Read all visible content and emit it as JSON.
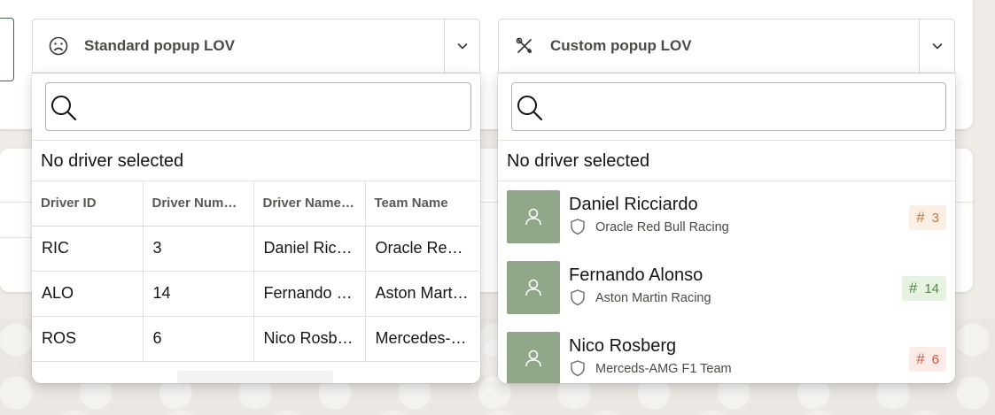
{
  "standard_lov": {
    "label": "Standard popup LOV",
    "icon": "sad-face-icon",
    "search_placeholder": "",
    "no_selection": "No driver selected",
    "columns": [
      "Driver ID",
      "Driver Number",
      "Driver Name…",
      "Team Name"
    ],
    "rows": [
      {
        "id": "RIC",
        "number": "3",
        "name": "Daniel Ric…",
        "team": "Oracle Red…"
      },
      {
        "id": "ALO",
        "number": "14",
        "name": "Fernando …",
        "team": "Aston Mart…"
      },
      {
        "id": "ROS",
        "number": "6",
        "name": "Nico Rosb…",
        "team": "Mercedes-…"
      }
    ]
  },
  "custom_lov": {
    "label": "Custom popup LOV",
    "icon": "tools-icon",
    "search_placeholder": "",
    "no_selection": "No driver selected",
    "items": [
      {
        "name": "Daniel Ricciardo",
        "team": "Oracle Red Bull Racing",
        "number": "3",
        "badge_fg": "#c9783b",
        "badge_bg": "#fbeee2"
      },
      {
        "name": "Fernando Alonso",
        "team": "Aston Martin Racing",
        "number": "14",
        "badge_fg": "#4f8a3d",
        "badge_bg": "#e7f3e1"
      },
      {
        "name": "Nico Rosberg",
        "team": "Merceds-AMG F1 Team",
        "number": "6",
        "badge_fg": "#d4533f",
        "badge_bg": "#fcebe7"
      }
    ]
  },
  "colors": {
    "avatar": "#91a78a",
    "focus_border": "#3d6b4e"
  }
}
